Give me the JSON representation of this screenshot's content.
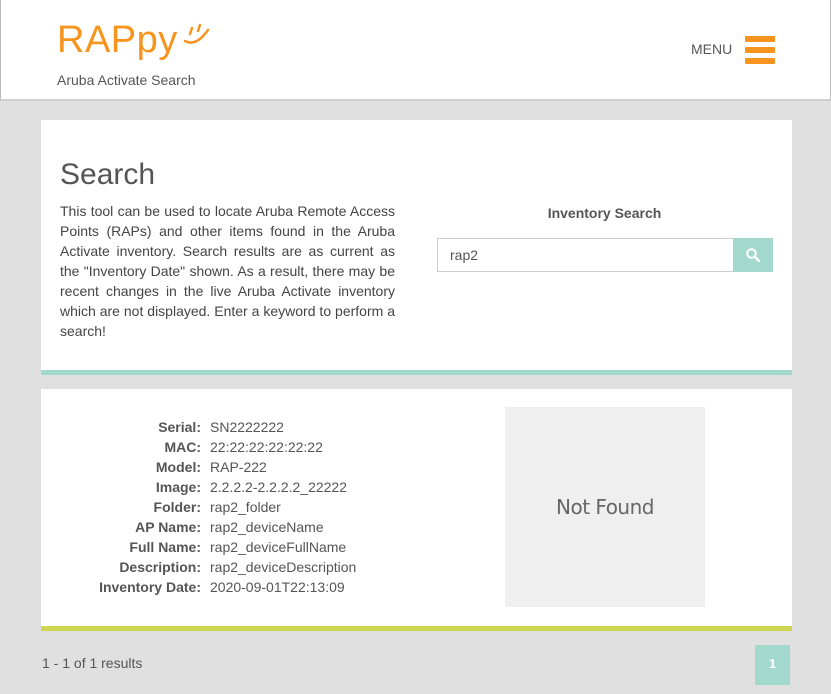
{
  "header": {
    "logo_text": "RAPpy",
    "logo_smile": ";)",
    "subtitle": "Aruba Activate Search",
    "menu_label": "MENU",
    "brand_color": "#f7941d"
  },
  "search_card": {
    "title": "Search",
    "description": "This tool can be used to locate Aruba Remote Access Points (RAPs) and other items found in the Aruba Activate inventory. Search results are as current as the \"Inventory Date\" shown. As a result, there may be recent changes in the live Aruba Activate inventory which are not displayed. Enter a keyword to perform a search!",
    "inventory_label": "Inventory Search",
    "search_value": "rap2",
    "search_icon": "search-icon",
    "accent_color": "#a3d9cd"
  },
  "result": {
    "fields": [
      {
        "label": "Serial:",
        "value": "SN2222222"
      },
      {
        "label": "MAC:",
        "value": "22:22:22:22:22:22"
      },
      {
        "label": "Model:",
        "value": "RAP-222"
      },
      {
        "label": "Image:",
        "value": "2.2.2.2-2.2.2.2_22222"
      },
      {
        "label": "Folder:",
        "value": "rap2_folder"
      },
      {
        "label": "AP Name:",
        "value": "rap2_deviceName"
      },
      {
        "label": "Full Name:",
        "value": "rap2_deviceFullName"
      },
      {
        "label": "Description:",
        "value": "rap2_deviceDescription"
      },
      {
        "label": "Inventory Date:",
        "value": "2020-09-01T22:13:09"
      }
    ],
    "image_text": "Not Found",
    "border_color": "#cdd551"
  },
  "pagination": {
    "results_text": "1 - 1 of 1 results",
    "current_page": "1"
  }
}
